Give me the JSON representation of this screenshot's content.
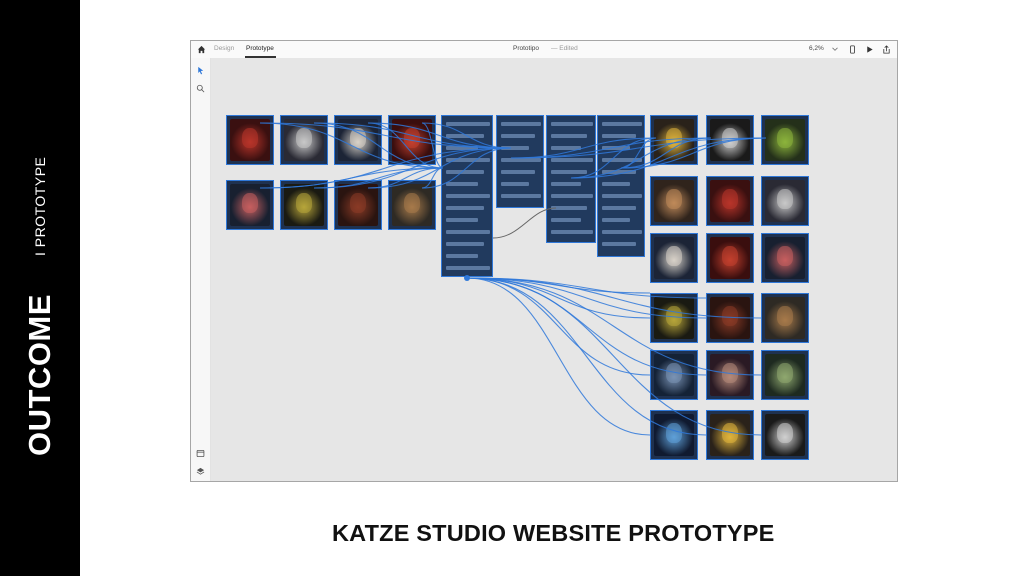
{
  "slide": {
    "side_title": "OUTCOME",
    "side_subtitle": "I PROTOTYPE",
    "caption": "KATZE STUDIO WEBSITE PROTOTYPE"
  },
  "app": {
    "tabs": [
      {
        "label": "Design",
        "active": false
      },
      {
        "label": "Prototype",
        "active": true
      }
    ],
    "document_title": "Prototipo",
    "document_status": "— Edited",
    "zoom_level": "6,2%",
    "icons": [
      "home-icon",
      "select-arrow-icon",
      "search-icon",
      "assets-icon",
      "layers-icon",
      "device-preview-icon",
      "play-icon",
      "share-icon",
      "chevron-down-icon"
    ]
  },
  "colors": {
    "accent": "#2f78d9",
    "canvas": "#e6e6e6",
    "board_dark": "#1e3150",
    "side_band": "#000000"
  }
}
